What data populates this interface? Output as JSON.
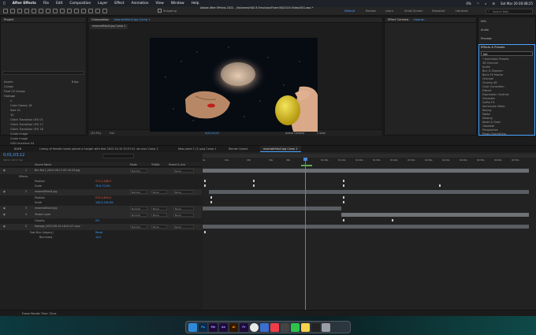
{
  "menubar": {
    "app": "After Effects",
    "items": [
      "File",
      "Edit",
      "Composition",
      "Layer",
      "Effect",
      "Animation",
      "View",
      "Window",
      "Help"
    ],
    "window_title": "Adobe After Effects 2022 - /Volumes/HAS 8 Emulsion/Fiverr/00/2024 Video/001.aep *",
    "battery": "0%",
    "datetime": "Sat Mar 26   00:08:25"
  },
  "toolbar": {
    "snapping": "Snapping",
    "workspaces": [
      "Default",
      "Review",
      "Learn",
      "Small Screen",
      "Standard",
      "Libraries"
    ],
    "active_workspace": "Default",
    "search_placeholder": "Search Help"
  },
  "project_panel": {
    "tab": "Project",
    "items": [
      "Assets",
      "Comps",
      "Final CS Comps",
      "Footage",
      "x",
      "Color Sweep 18",
      "Sale 01",
      "10",
      "Glitch Transition UFX 01",
      "Glitch Transition UFX 17",
      "Glitch Transition UFX 18",
      "Guide image",
      "Guide image",
      "HUD Interface 04"
    ],
    "bpc": "8 bpc"
  },
  "composition_panel": {
    "tab": "Composition",
    "comp_name": "moonwithbull.jpg Comp 1",
    "subtab": "moonwithbull.jpg Comp 1",
    "zoom": "(33.3%)",
    "quality": "Full",
    "timecode": "0;01;03;12",
    "camera": "Active Camera",
    "views": "1 View"
  },
  "effect_controls": {
    "tab": "Effect Controls",
    "layer": "moonw..."
  },
  "right_panels": {
    "info": "Info",
    "audio": "Audio",
    "preview": "Preview",
    "effects_presets": "Effects & Presets",
    "search_value": "fad",
    "categories": [
      "* Animation Presets",
      "3D Channel",
      "Audio",
      "Blur & Sharpen",
      "Boris FX Mocha",
      "Channel",
      "Cinema 4D",
      "Color Correction",
      "Distort",
      "Expression Controls",
      "Generate",
      "GoPro FX",
      "Immersive Video",
      "Keying",
      "Matte",
      "Missing",
      "Noise & Grain",
      "Obsolete",
      "Perspective",
      "Plugin Everything"
    ]
  },
  "timeline": {
    "tabs": [
      "BAEN",
      "Lineup of female hands placed a hanger with text 2023-10-10 20:57:41 utc.mov Comp 1",
      "New piece 2 (1).png Comp 1",
      "Render Queue",
      "moonwithbull.jpg Comp 1"
    ],
    "active_tab": "moonwithbull.jpg Comp 1",
    "timecode": "0;01;03;12",
    "frame_info": "00012 (29.97 fps)",
    "col_headers": {
      "source": "Source Name",
      "mode": "Mode",
      "trkmat": "TrkMat",
      "parent": "Parent & Link"
    },
    "ruler": [
      "0s",
      "10s",
      "20s",
      "30s",
      "40s",
      "50s",
      "01:00s",
      "01:10s",
      "01:20s",
      "01:30s",
      "01:40s",
      "01:50s",
      "02:00s",
      "02:10s",
      "02:20s",
      "02:30s",
      "02:40s",
      "02:50s",
      "03:00s",
      "03:10s"
    ],
    "layers": [
      {
        "num": "1",
        "name": "Bro Bro1_2023-08-17-05-16-43.jpg",
        "mode": "Normal",
        "trk": "",
        "parent": "None"
      },
      {
        "num": "",
        "name": "Effects",
        "mode": "",
        "trk": "",
        "parent": ""
      },
      {
        "num": "",
        "name": "Position",
        "value": "571.5,268.5",
        "red": true
      },
      {
        "num": "",
        "name": "Scale",
        "value": "70.0,70.0%",
        "red": false
      },
      {
        "num": "2",
        "name": "moonwithbull.jpg",
        "mode": "Normal",
        "trk": "None",
        "parent": "None"
      },
      {
        "num": "",
        "name": "Position",
        "value": "973.5,659.0",
        "red": true
      },
      {
        "num": "",
        "name": "Scale",
        "value": "100.0,100.0%",
        "red": false
      },
      {
        "num": "3",
        "name": "moonwithbull.jpg",
        "mode": "Normal",
        "trk": "None",
        "parent": "None"
      },
      {
        "num": "4",
        "name": "Shape Layer",
        "mode": "Normal",
        "trk": "None",
        "parent": "None"
      },
      {
        "num": "",
        "name": "Opacity",
        "value": "0%",
        "red": false
      },
      {
        "num": "5",
        "name": "footage_2023-09-10-16-01-07.mov",
        "mode": "Normal",
        "trk": "None",
        "parent": "None"
      },
      {
        "num": "",
        "name": "Fast Blur (Legacy)",
        "value": "Reset",
        "red": false
      },
      {
        "num": "",
        "name": "Blurriness",
        "value": "10.0",
        "red": false
      }
    ],
    "footer": "Frame Render Time: 22ms"
  },
  "dock": {
    "apps": [
      "Finder",
      "Ps",
      "Me",
      "Ae",
      "Ai",
      "Pr",
      "Chrome",
      "Files",
      "Music",
      "Calc",
      "Msg",
      "Notes",
      "Term",
      "Trash"
    ]
  },
  "colors": {
    "accent": "#4aa3ff",
    "playhead": "#4a88d8"
  }
}
